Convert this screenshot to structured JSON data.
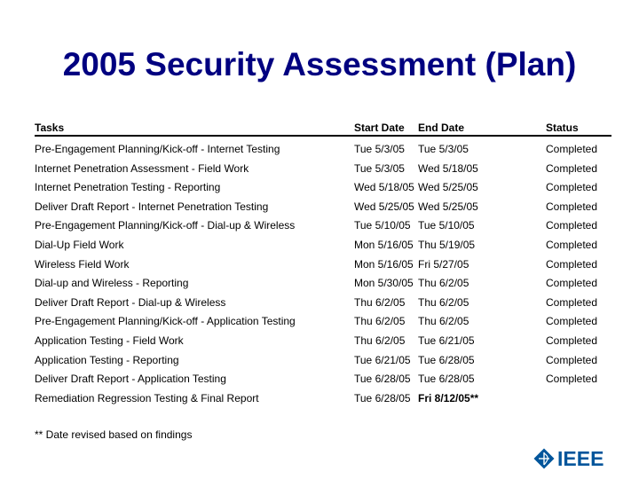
{
  "slide": {
    "title": "2005 Security Assessment (Plan)"
  },
  "table": {
    "headers": {
      "task": "Tasks",
      "start": "Start Date",
      "end": "End Date",
      "status": "Status"
    },
    "rows": [
      {
        "task": "Pre-Engagement Planning/Kick-off - Internet Testing",
        "start": "Tue 5/3/05",
        "end": "Tue 5/3/05",
        "status": "Completed"
      },
      {
        "task": "Internet Penetration Assessment - Field Work",
        "start": "Tue 5/3/05",
        "end": "Wed 5/18/05",
        "status": "Completed"
      },
      {
        "task": "Internet Penetration Testing - Reporting",
        "start": "Wed 5/18/05",
        "end": "Wed 5/25/05",
        "status": "Completed"
      },
      {
        "task": "Deliver Draft Report - Internet Penetration Testing",
        "start": "Wed 5/25/05",
        "end": "Wed 5/25/05",
        "status": "Completed"
      },
      {
        "task": "Pre-Engagement Planning/Kick-off - Dial-up & Wireless",
        "start": "Tue 5/10/05",
        "end": "Tue 5/10/05",
        "status": "Completed"
      },
      {
        "task": "Dial-Up Field Work",
        "start": "Mon 5/16/05",
        "end": "Thu 5/19/05",
        "status": "Completed"
      },
      {
        "task": "Wireless Field Work",
        "start": "Mon 5/16/05",
        "end": "Fri 5/27/05",
        "status": "Completed"
      },
      {
        "task": "Dial-up and Wireless - Reporting",
        "start": "Mon 5/30/05",
        "end": "Thu 6/2/05",
        "status": "Completed"
      },
      {
        "task": "Deliver Draft Report - Dial-up & Wireless",
        "start": "Thu 6/2/05",
        "end": "Thu 6/2/05",
        "status": "Completed"
      },
      {
        "task": "Pre-Engagement Planning/Kick-off - Application Testing",
        "start": "Thu 6/2/05",
        "end": "Thu 6/2/05",
        "status": "Completed"
      },
      {
        "task": "Application Testing - Field Work",
        "start": "Thu 6/2/05",
        "end": "Tue 6/21/05",
        "status": "Completed"
      },
      {
        "task": "Application Testing - Reporting",
        "start": "Tue 6/21/05",
        "end": "Tue 6/28/05",
        "status": "Completed"
      },
      {
        "task": "Deliver Draft Report - Application Testing",
        "start": "Tue 6/28/05",
        "end": "Tue 6/28/05",
        "status": "Completed"
      },
      {
        "task": "Remediation Regression Testing & Final Report",
        "start": "Tue 6/28/05",
        "end": "Fri 8/12/05**",
        "status": "",
        "end_emphasis": true
      }
    ]
  },
  "footnote": "** Date revised based on findings",
  "logo": {
    "text": "IEEE",
    "icon": "ieee-diamond-kite-icon",
    "color": "#00559b"
  },
  "colors": {
    "title": "#000080",
    "text": "#000000",
    "background": "#ffffff"
  }
}
